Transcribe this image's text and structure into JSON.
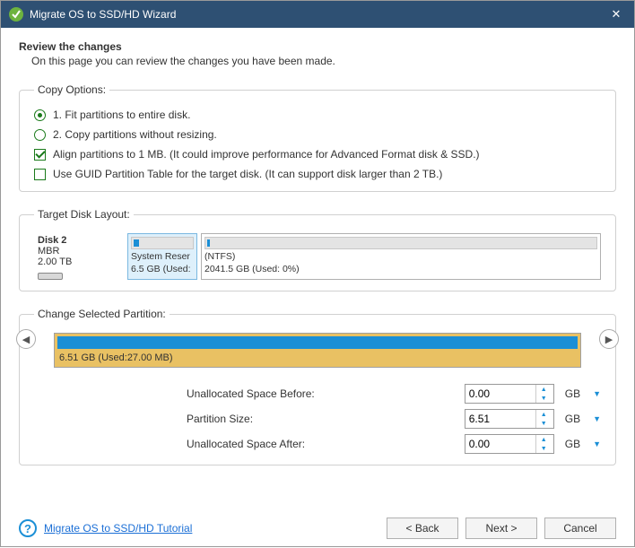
{
  "window": {
    "title": "Migrate OS to SSD/HD Wizard"
  },
  "header": {
    "title": "Review the changes",
    "subtitle": "On this page you can review the changes you have been made."
  },
  "copy_options": {
    "legend": "Copy Options:",
    "radio1": "1. Fit partitions to entire disk.",
    "radio2": "2. Copy partitions without resizing.",
    "check1": "Align partitions to 1 MB.  (It could improve performance for Advanced Format disk & SSD.)",
    "check2": "Use GUID Partition Table for the target disk. (It can support disk larger than 2 TB.)"
  },
  "target_layout": {
    "legend": "Target Disk Layout:",
    "disk": {
      "name": "Disk 2",
      "type": "MBR",
      "size": "2.00 TB"
    },
    "part1": {
      "name": "System Reser",
      "detail": "6.5 GB (Used:"
    },
    "part2": {
      "name": "(NTFS)",
      "detail": "2041.5 GB (Used: 0%)"
    }
  },
  "change_partition": {
    "legend": "Change Selected Partition:",
    "label": "6.51 GB (Used:27.00 MB)"
  },
  "form": {
    "before_label": "Unallocated Space Before:",
    "before_value": "0.00",
    "size_label": "Partition Size:",
    "size_value": "6.51",
    "after_label": "Unallocated Space After:",
    "after_value": "0.00",
    "unit": "GB"
  },
  "footer": {
    "tutorial": "Migrate OS to SSD/HD Tutorial",
    "back": "< Back",
    "next": "Next >",
    "cancel": "Cancel"
  }
}
